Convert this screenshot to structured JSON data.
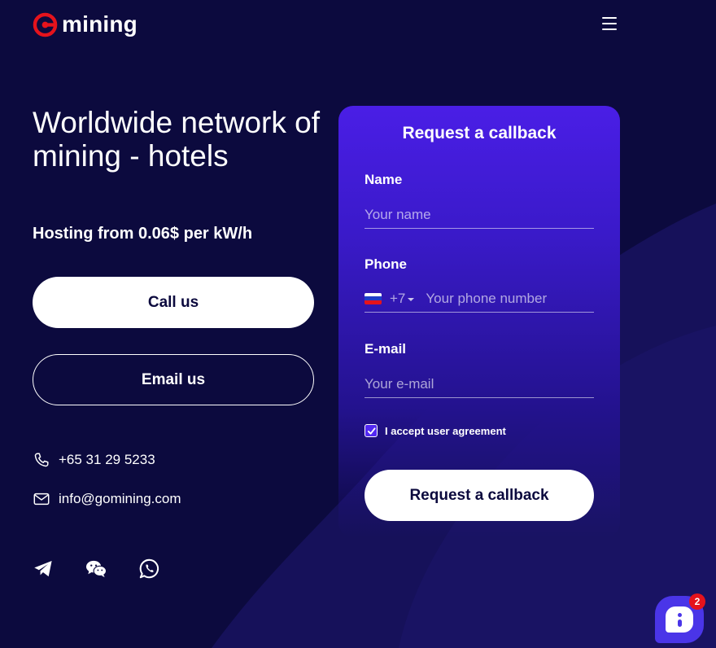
{
  "colors": {
    "background": "#0c0a3e",
    "card_top": "#4a1ee6",
    "accent": "#5228f2",
    "logo_red": "#e5131c",
    "chat": "#4a35e8"
  },
  "header": {
    "logo_text": "mining",
    "logo_icon": "gomining-logo-icon",
    "menu_icon": "hamburger-menu-icon"
  },
  "hero": {
    "title": "Worldwide network of mining - hotels",
    "subtitle": "Hosting from 0.06$ per kW/h",
    "call_button": "Call us",
    "email_button": "Email us"
  },
  "contacts": {
    "phone": "+65 31 29 5233",
    "phone_icon": "phone-icon",
    "email": "info@gomining.com",
    "email_icon": "envelope-icon"
  },
  "socials": [
    {
      "name": "telegram-icon"
    },
    {
      "name": "wechat-icon"
    },
    {
      "name": "whatsapp-icon"
    }
  ],
  "form": {
    "title": "Request a callback",
    "name_label": "Name",
    "name_placeholder": "Your name",
    "name_value": "",
    "phone_label": "Phone",
    "phone_country": "RU",
    "phone_dial_code": "+7",
    "phone_placeholder": "Your phone number",
    "phone_value": "",
    "email_label": "E-mail",
    "email_placeholder": "Your e-mail",
    "email_value": "",
    "agreement_label": "I accept user agreement",
    "agreement_checked": true,
    "submit_label": "Request a callback"
  },
  "chat_widget": {
    "badge_count": "2",
    "icon": "chat-icon"
  }
}
